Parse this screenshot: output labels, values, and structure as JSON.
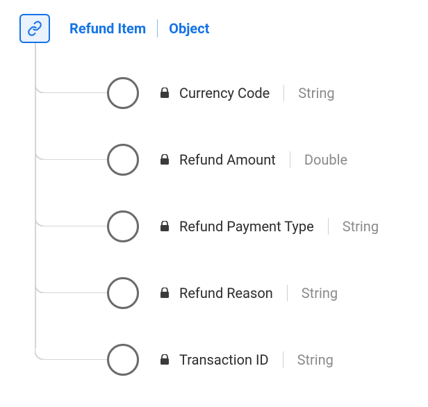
{
  "root": {
    "name": "Refund Item",
    "type": "Object"
  },
  "fields": [
    {
      "name": "Currency Code",
      "type": "String"
    },
    {
      "name": "Refund Amount",
      "type": "Double"
    },
    {
      "name": "Refund Payment Type",
      "type": "String"
    },
    {
      "name": "Refund Reason",
      "type": "String"
    },
    {
      "name": "Transaction ID",
      "type": "String"
    }
  ]
}
